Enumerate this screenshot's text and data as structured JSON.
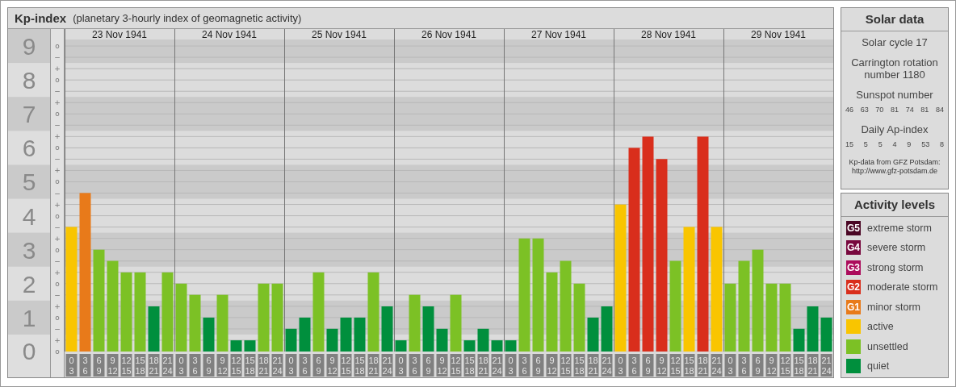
{
  "kp_panel": {
    "title": "Kp-index",
    "subtitle": "(planetary 3-hourly index of geomagnetic activity)",
    "days": [
      "23 Nov 1941",
      "24 Nov 1941",
      "25 Nov 1941",
      "26 Nov 1941",
      "27 Nov 1941",
      "28 Nov 1941",
      "29 Nov 1941"
    ],
    "minor_tick_labels": [
      "o",
      "−",
      "+",
      "o",
      "−",
      "+",
      "o",
      "−",
      "+",
      "o",
      "−",
      "+",
      "o",
      "−",
      "+",
      "o",
      "−",
      "+",
      "o",
      "−",
      "+",
      "o",
      "−",
      "+",
      "o",
      "−",
      "+",
      "o"
    ],
    "chart_data": {
      "type": "bar",
      "grid": true,
      "ylim": [
        0,
        9.5
      ],
      "yticks": [
        {
          "value": 0,
          "label": "0"
        },
        {
          "value": 1,
          "label": "1"
        },
        {
          "value": 2,
          "label": "2"
        },
        {
          "value": 3,
          "label": "3"
        },
        {
          "value": 4,
          "label": "4"
        },
        {
          "value": 5,
          "label": "5"
        },
        {
          "value": 6,
          "label": "6"
        },
        {
          "value": 7,
          "label": "7"
        },
        {
          "value": 8,
          "label": "8"
        },
        {
          "value": 9,
          "label": "9"
        }
      ],
      "categories": [
        "0\n3",
        "3\n6",
        "6\n9",
        "9\n12",
        "12\n15",
        "15\n18",
        "18\n21",
        "21\n24",
        "0\n3",
        "3\n6",
        "6\n9",
        "9\n12",
        "12\n15",
        "15\n18",
        "18\n21",
        "21\n24",
        "0\n3",
        "3\n6",
        "6\n9",
        "9\n12",
        "12\n15",
        "15\n18",
        "18\n21",
        "21\n24",
        "0\n3",
        "3\n6",
        "6\n9",
        "9\n12",
        "12\n15",
        "15\n18",
        "18\n21",
        "21\n24",
        "0\n3",
        "3\n6",
        "6\n9",
        "9\n12",
        "12\n15",
        "15\n18",
        "18\n21",
        "21\n24",
        "0\n3",
        "3\n6",
        "6\n9",
        "9\n12",
        "12\n15",
        "15\n18",
        "18\n21",
        "21\n24",
        "0\n3",
        "3\n6",
        "6\n9",
        "9\n12",
        "12\n15",
        "15\n18",
        "18\n21",
        "21\n24"
      ],
      "series": [
        {
          "color": "#d92e1c",
          "values": [
            null,
            null,
            null,
            null,
            null,
            null,
            null,
            null,
            null,
            null,
            null,
            null,
            null,
            null,
            null,
            null,
            null,
            null,
            null,
            null,
            null,
            null,
            null,
            null,
            null,
            null,
            null,
            null,
            null,
            null,
            null,
            null,
            null,
            null,
            null,
            null,
            null,
            null,
            null,
            null,
            null,
            6,
            6.33,
            5.67,
            null,
            null,
            6.33,
            null,
            null,
            null,
            null,
            null,
            null,
            null,
            null,
            null
          ]
        },
        {
          "color": "#e87a1a",
          "values": [
            null,
            4.67,
            null,
            null,
            null,
            null,
            null,
            null,
            null,
            null,
            null,
            null,
            null,
            null,
            null,
            null,
            null,
            null,
            null,
            null,
            null,
            null,
            null,
            null,
            null,
            null,
            null,
            null,
            null,
            null,
            null,
            null,
            null,
            null,
            null,
            null,
            null,
            null,
            null,
            null,
            null,
            null,
            null,
            null,
            null,
            null,
            null,
            null,
            null,
            null,
            null,
            null,
            null,
            null,
            null,
            null
          ]
        },
        {
          "color": "#f9c500",
          "values": [
            3.67,
            null,
            null,
            null,
            null,
            null,
            null,
            null,
            null,
            null,
            null,
            null,
            null,
            null,
            null,
            null,
            null,
            null,
            null,
            null,
            null,
            null,
            null,
            null,
            null,
            null,
            null,
            null,
            null,
            null,
            null,
            null,
            null,
            null,
            null,
            null,
            null,
            null,
            null,
            null,
            4.33,
            null,
            null,
            null,
            null,
            3.67,
            null,
            3.67,
            null,
            null,
            null,
            null,
            null,
            null,
            null,
            null
          ]
        },
        {
          "color": "#7cc125",
          "values": [
            null,
            null,
            3,
            2.67,
            2.33,
            2.33,
            null,
            2.33,
            2,
            1.67,
            null,
            1.67,
            null,
            null,
            2,
            2,
            null,
            null,
            2.33,
            null,
            null,
            null,
            2.33,
            null,
            null,
            1.67,
            null,
            null,
            1.67,
            null,
            null,
            null,
            null,
            3.33,
            3.33,
            2.33,
            2.67,
            2,
            null,
            null,
            null,
            null,
            null,
            null,
            2.67,
            null,
            null,
            null,
            2,
            2.67,
            3,
            2,
            2,
            null,
            null,
            null
          ]
        },
        {
          "color": "#008f3d",
          "values": [
            null,
            null,
            null,
            null,
            null,
            null,
            1.33,
            null,
            null,
            null,
            1,
            null,
            0.33,
            0.33,
            null,
            null,
            0.67,
            1,
            null,
            0.67,
            1,
            1,
            null,
            1.33,
            0.33,
            null,
            1.33,
            0.67,
            null,
            0.33,
            0.67,
            0.33,
            0.33,
            null,
            null,
            null,
            null,
            null,
            1,
            1.33,
            null,
            null,
            null,
            null,
            null,
            null,
            null,
            null,
            null,
            null,
            null,
            null,
            null,
            0.67,
            1.33,
            1
          ]
        }
      ]
    }
  },
  "solar_data": {
    "title": "Solar data",
    "solar_cycle": "Solar cycle 17",
    "carrington": "Carrington rotation number 1180",
    "sunspot_heading": "Sunspot number",
    "sunspot_numbers": [
      "46",
      "63",
      "70",
      "81",
      "74",
      "81",
      "84"
    ],
    "ap_heading": "Daily Ap-index",
    "ap_values": [
      "15",
      "5",
      "5",
      "4",
      "9",
      "53",
      "8"
    ],
    "credit_lines": [
      "Kp-data from GFZ Potsdam:",
      "http://www.gfz-potsdam.de"
    ]
  },
  "activity_levels": {
    "title": "Activity levels",
    "items": [
      {
        "kind": "badge",
        "badge": "G5",
        "label": "extreme storm",
        "color": "#4a0624"
      },
      {
        "kind": "badge",
        "badge": "G4",
        "label": "severe storm",
        "color": "#78083e"
      },
      {
        "kind": "badge",
        "badge": "G3",
        "label": "strong storm",
        "color": "#ac0c5c"
      },
      {
        "kind": "badge",
        "badge": "G2",
        "label": "moderate storm",
        "color": "#d92e1c"
      },
      {
        "kind": "badge",
        "badge": "G1",
        "label": "minor storm",
        "color": "#e87a1a"
      },
      {
        "kind": "swatch",
        "label": "active",
        "color": "#f9c500"
      },
      {
        "kind": "swatch",
        "label": "unsettled",
        "color": "#7cc125"
      },
      {
        "kind": "swatch",
        "label": "quiet",
        "color": "#008f3d"
      }
    ]
  }
}
